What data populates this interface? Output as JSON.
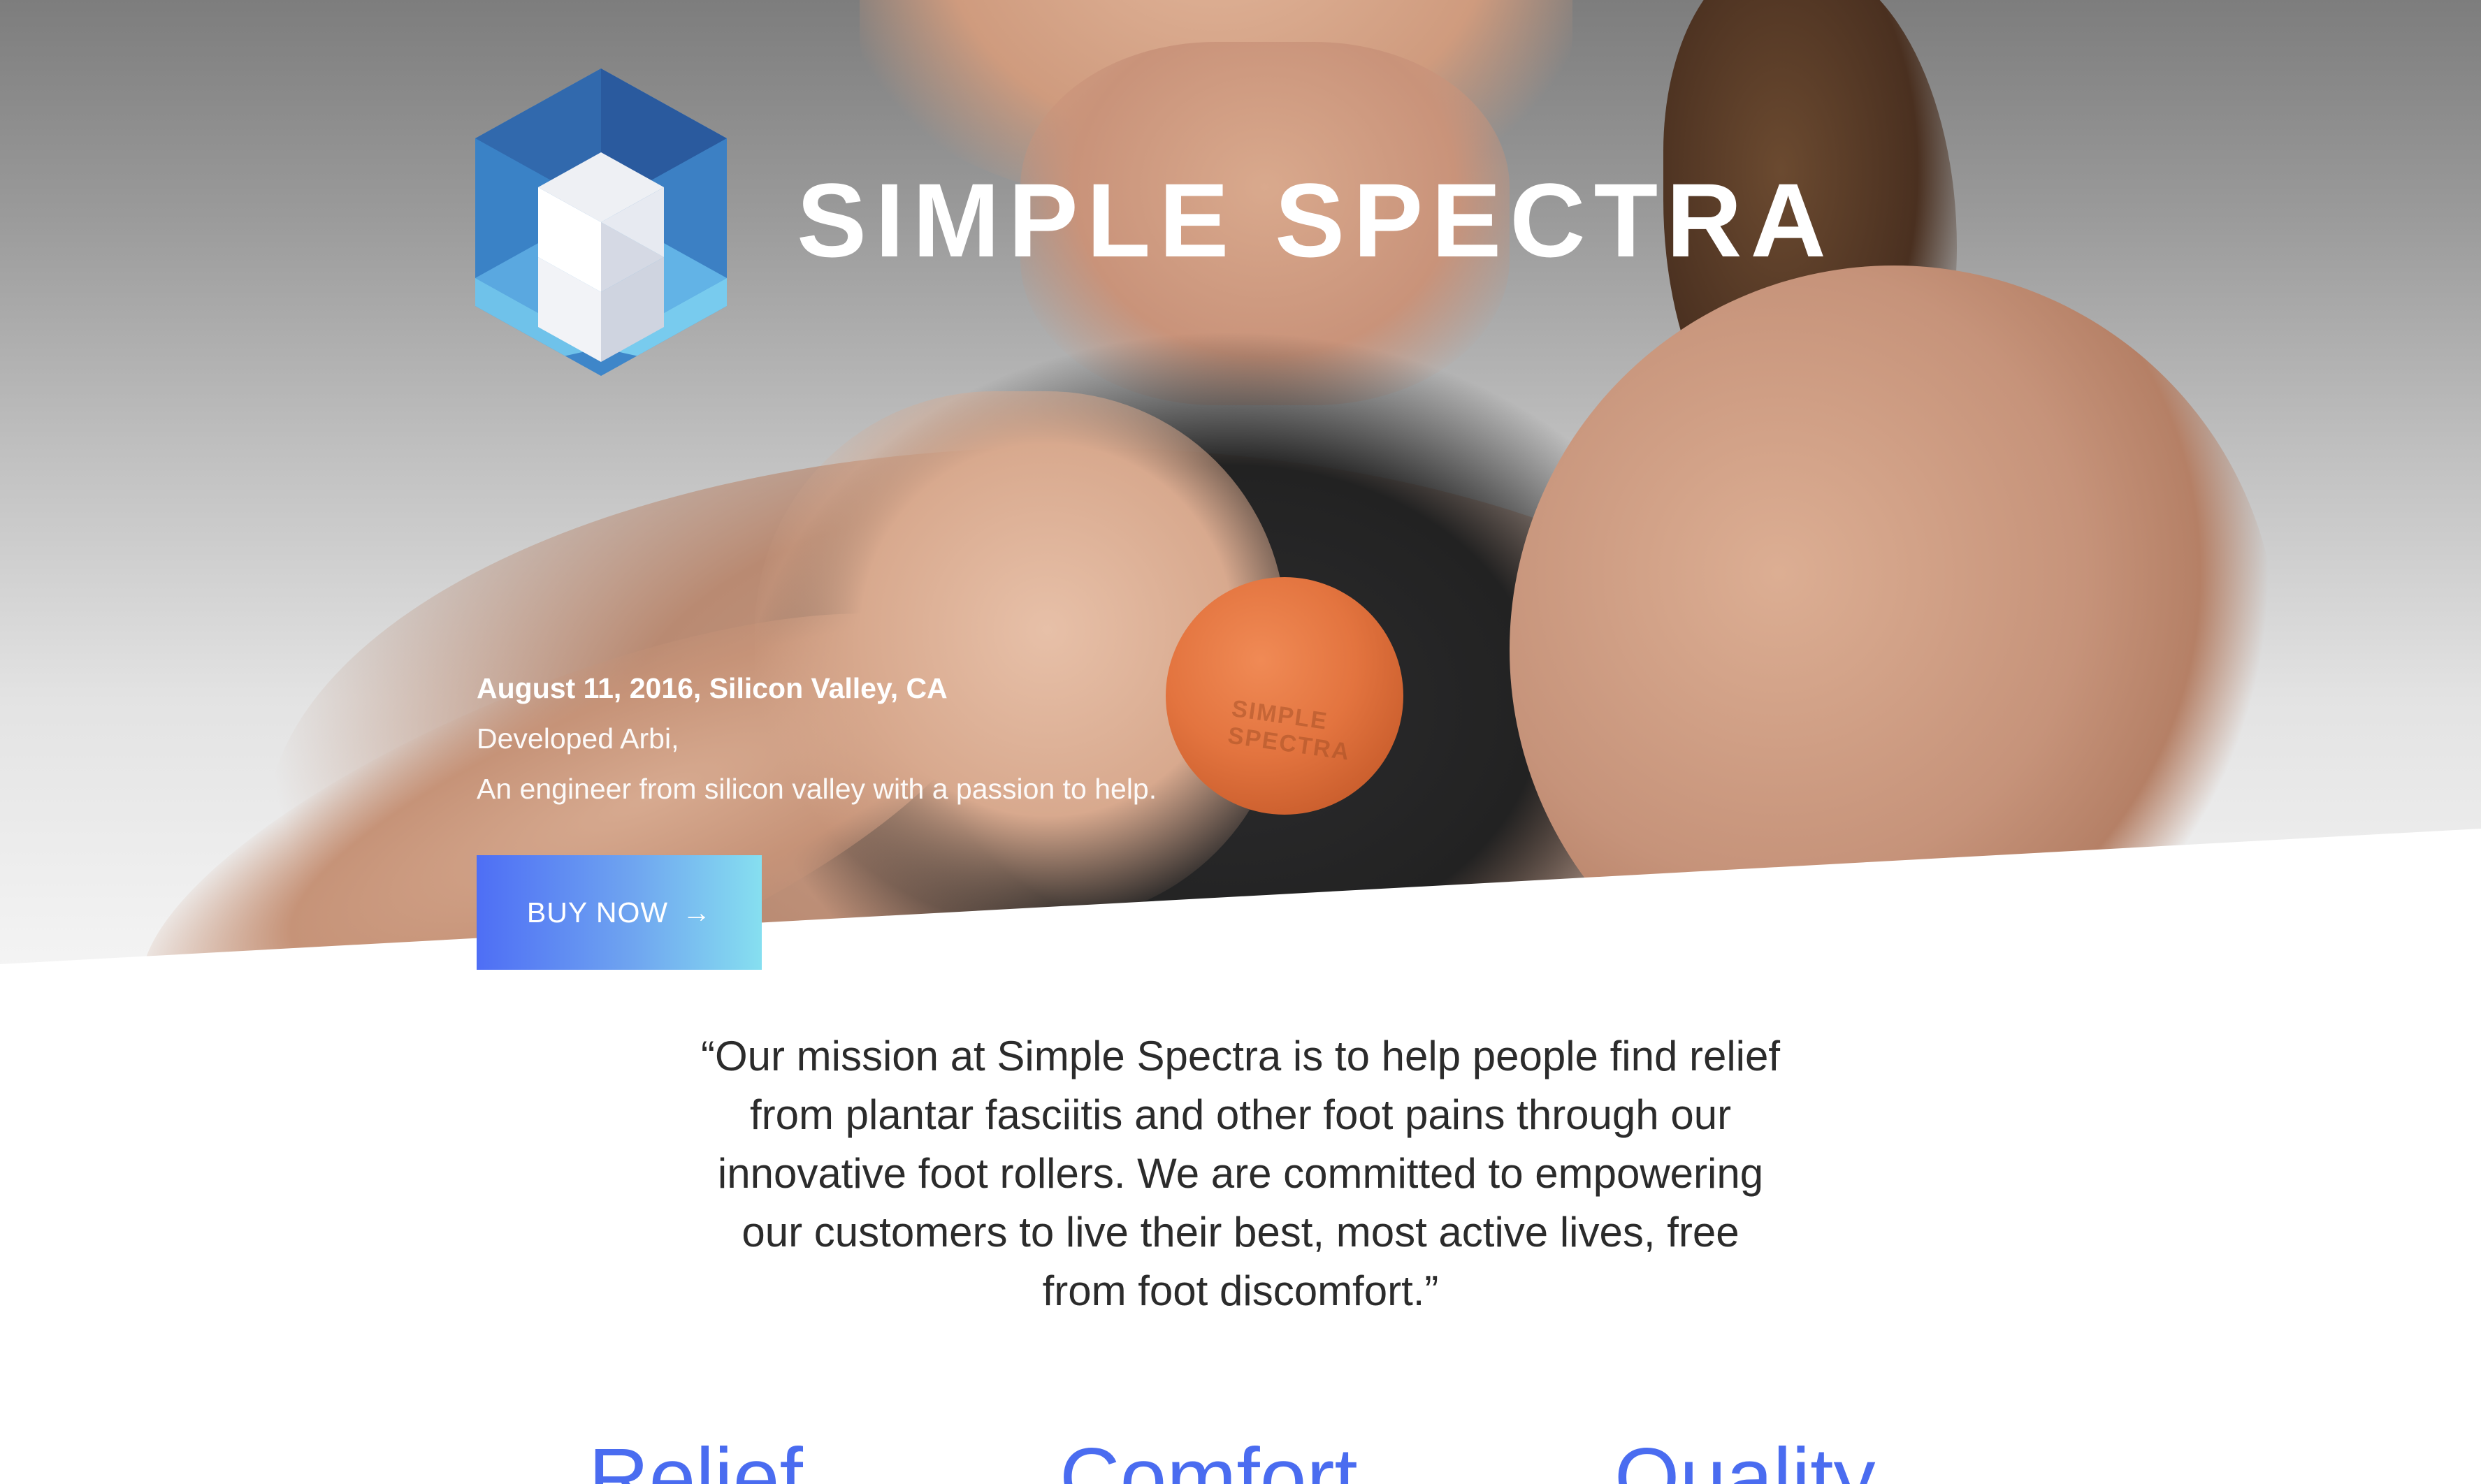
{
  "brand": {
    "name": "SIMPLE SPECTRA",
    "ball_print": "SIMPLE SPECTRA"
  },
  "hero": {
    "dateline": "August 11, 2016, Silicon Valley, CA",
    "line1": "Developed Arbi,",
    "line2": "An engineer from silicon valley with a passion to help.",
    "cta_label": "BUY NOW",
    "cta_arrow": "→"
  },
  "mission": {
    "text": "“Our mission at Simple Spectra is to help people find relief from plantar fasciitis and other foot pains through our innovative foot rollers. We are committed to empowering our customers to live their best, most active lives, free from foot discomfort.”"
  },
  "values": [
    {
      "label": "Relief"
    },
    {
      "label": "Comfort"
    },
    {
      "label": "Quality"
    }
  ],
  "colors": {
    "accent": "#4a6cf0",
    "cta_gradient_start": "#4e6ef5",
    "cta_gradient_end": "#86dff0",
    "ball": "#e3743f",
    "logo_blue_dark": "#2a5a9e",
    "logo_blue_light": "#6fc2ea"
  },
  "icons": {
    "logo": "hexagon-s-logo-icon",
    "cta": "arrow-right-icon"
  }
}
